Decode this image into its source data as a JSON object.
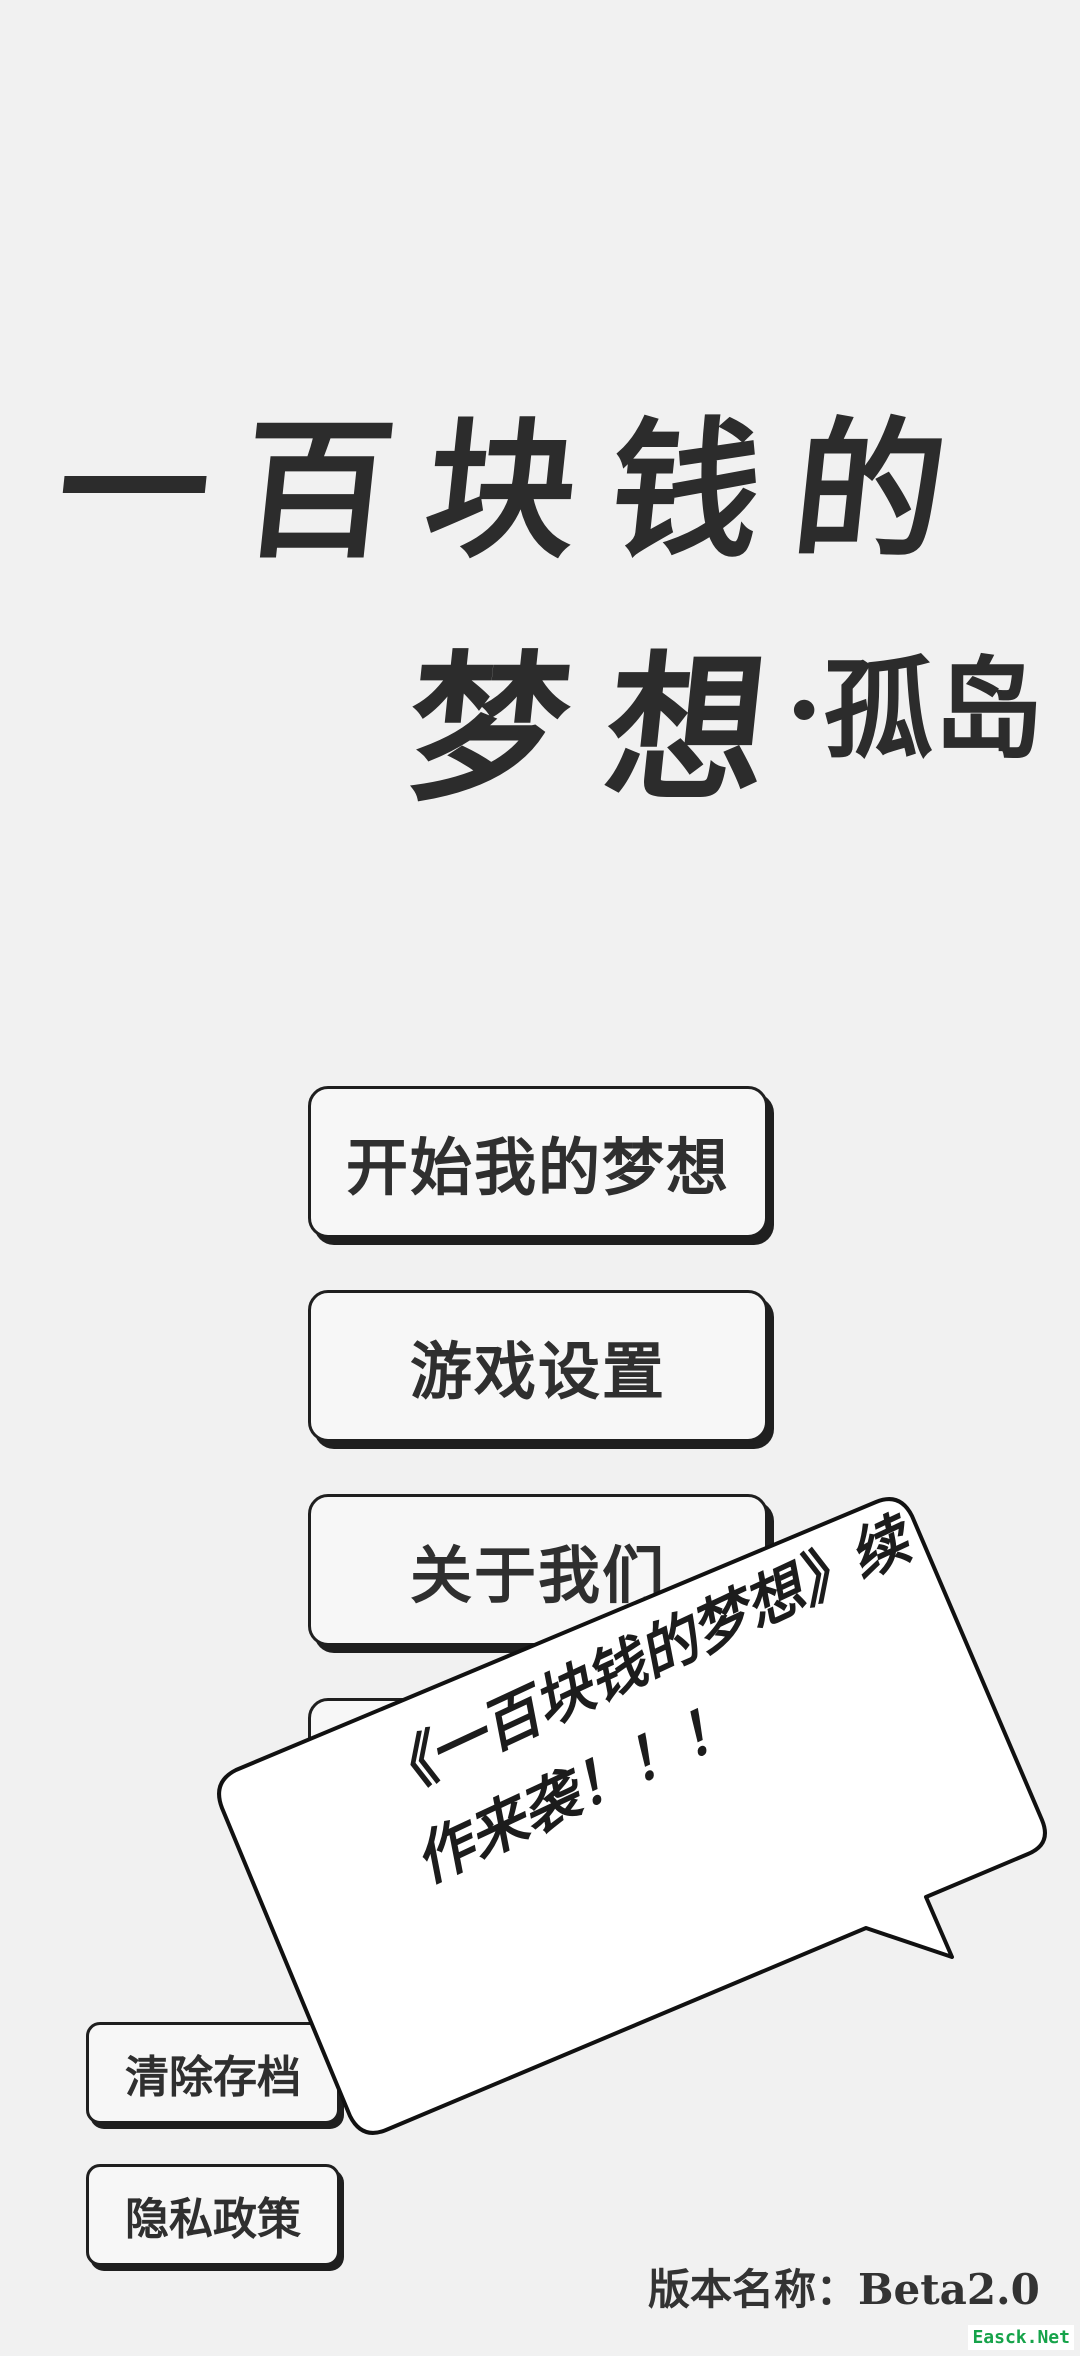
{
  "title": {
    "line1": "一百块钱的",
    "line2": "梦想",
    "subtitle": "·孤岛"
  },
  "menu": {
    "start": "开始我的梦想",
    "settings": "游戏设置",
    "about": "关于我们"
  },
  "side_buttons": {
    "clear_save": "清除存档",
    "privacy": "隐私政策"
  },
  "popup": {
    "line1": "《一百块钱的梦想》续",
    "line2": "作来袭！！！"
  },
  "version": "版本名称：Beta2.0",
  "watermark": "Easck.Net",
  "colors": {
    "background": "#f1f1f1",
    "button_fill": "#f7f7f7",
    "border": "#1f1f1f",
    "text": "#2c2c2c"
  }
}
